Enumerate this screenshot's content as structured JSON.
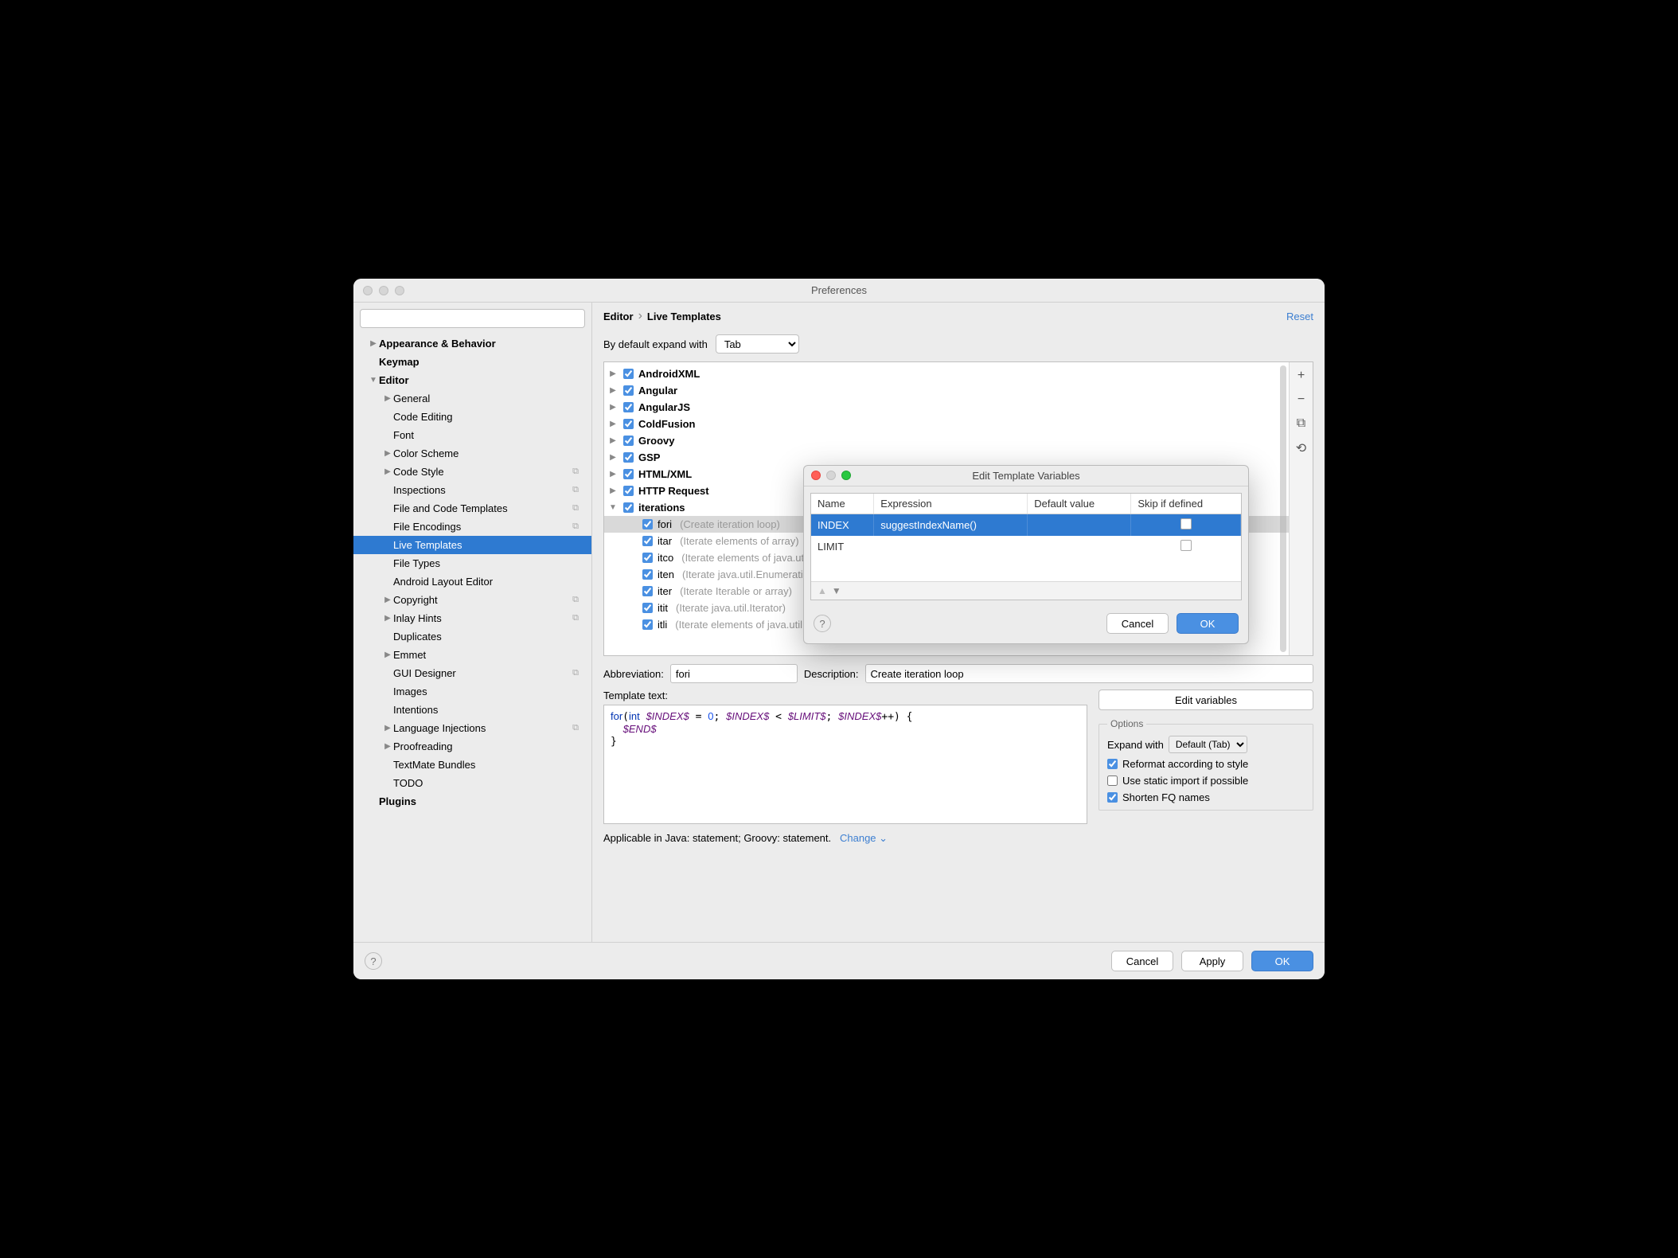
{
  "window": {
    "title": "Preferences"
  },
  "breadcrumb": {
    "parent": "Editor",
    "current": "Live Templates",
    "reset": "Reset"
  },
  "search": {
    "placeholder": ""
  },
  "sidebar": [
    {
      "label": "Appearance & Behavior",
      "depth": 0,
      "arrow": "right",
      "bold": true
    },
    {
      "label": "Keymap",
      "depth": 0,
      "arrow": "none",
      "bold": true
    },
    {
      "label": "Editor",
      "depth": 0,
      "arrow": "down",
      "bold": true
    },
    {
      "label": "General",
      "depth": 1,
      "arrow": "right"
    },
    {
      "label": "Code Editing",
      "depth": 1,
      "arrow": "none"
    },
    {
      "label": "Font",
      "depth": 1,
      "arrow": "none"
    },
    {
      "label": "Color Scheme",
      "depth": 1,
      "arrow": "right"
    },
    {
      "label": "Code Style",
      "depth": 1,
      "arrow": "right",
      "badge": "⧉"
    },
    {
      "label": "Inspections",
      "depth": 1,
      "arrow": "none",
      "badge": "⧉"
    },
    {
      "label": "File and Code Templates",
      "depth": 1,
      "arrow": "none",
      "badge": "⧉"
    },
    {
      "label": "File Encodings",
      "depth": 1,
      "arrow": "none",
      "badge": "⧉"
    },
    {
      "label": "Live Templates",
      "depth": 1,
      "arrow": "none",
      "selected": true
    },
    {
      "label": "File Types",
      "depth": 1,
      "arrow": "none"
    },
    {
      "label": "Android Layout Editor",
      "depth": 1,
      "arrow": "none"
    },
    {
      "label": "Copyright",
      "depth": 1,
      "arrow": "right",
      "badge": "⧉"
    },
    {
      "label": "Inlay Hints",
      "depth": 1,
      "arrow": "right",
      "badge": "⧉"
    },
    {
      "label": "Duplicates",
      "depth": 1,
      "arrow": "none"
    },
    {
      "label": "Emmet",
      "depth": 1,
      "arrow": "right"
    },
    {
      "label": "GUI Designer",
      "depth": 1,
      "arrow": "none",
      "badge": "⧉"
    },
    {
      "label": "Images",
      "depth": 1,
      "arrow": "none"
    },
    {
      "label": "Intentions",
      "depth": 1,
      "arrow": "none"
    },
    {
      "label": "Language Injections",
      "depth": 1,
      "arrow": "right",
      "badge": "⧉"
    },
    {
      "label": "Proofreading",
      "depth": 1,
      "arrow": "right"
    },
    {
      "label": "TextMate Bundles",
      "depth": 1,
      "arrow": "none"
    },
    {
      "label": "TODO",
      "depth": 1,
      "arrow": "none"
    },
    {
      "label": "Plugins",
      "depth": 0,
      "arrow": "none",
      "bold": true
    }
  ],
  "expand": {
    "label": "By default expand with",
    "value": "Tab"
  },
  "templates": [
    {
      "label": "AndroidXML",
      "depth": 0,
      "arrow": "right",
      "checked": true,
      "bold": true
    },
    {
      "label": "Angular",
      "depth": 0,
      "arrow": "right",
      "checked": true,
      "bold": true
    },
    {
      "label": "AngularJS",
      "depth": 0,
      "arrow": "right",
      "checked": true,
      "bold": true
    },
    {
      "label": "ColdFusion",
      "depth": 0,
      "arrow": "right",
      "checked": true,
      "bold": true
    },
    {
      "label": "Groovy",
      "depth": 0,
      "arrow": "right",
      "checked": true,
      "bold": true
    },
    {
      "label": "GSP",
      "depth": 0,
      "arrow": "right",
      "checked": true,
      "bold": true
    },
    {
      "label": "HTML/XML",
      "depth": 0,
      "arrow": "right",
      "checked": true,
      "bold": true
    },
    {
      "label": "HTTP Request",
      "depth": 0,
      "arrow": "right",
      "checked": true,
      "bold": true
    },
    {
      "label": "iterations",
      "depth": 0,
      "arrow": "down",
      "checked": true,
      "bold": true
    },
    {
      "label": "fori",
      "desc": "(Create iteration loop)",
      "depth": 1,
      "arrow": "none",
      "checked": true,
      "selected": true
    },
    {
      "label": "itar",
      "desc": "(Iterate elements of array)",
      "depth": 1,
      "arrow": "none",
      "checked": true
    },
    {
      "label": "itco",
      "desc": "(Iterate elements of java.util.Collection)",
      "depth": 1,
      "arrow": "none",
      "checked": true
    },
    {
      "label": "iten",
      "desc": "(Iterate java.util.Enumeration)",
      "depth": 1,
      "arrow": "none",
      "checked": true
    },
    {
      "label": "iter",
      "desc": "(Iterate Iterable or array)",
      "depth": 1,
      "arrow": "none",
      "checked": true
    },
    {
      "label": "itit",
      "desc": "(Iterate java.util.Iterator)",
      "depth": 1,
      "arrow": "none",
      "checked": true
    },
    {
      "label": "itli",
      "desc": "(Iterate elements of java.util.List)",
      "depth": 1,
      "arrow": "none",
      "checked": true
    }
  ],
  "rightToolbar": {
    "add": "+",
    "remove": "−",
    "duplicate": "⧉",
    "revert": "⟲"
  },
  "form": {
    "abbrLabel": "Abbreviation:",
    "abbrValue": "fori",
    "descLabel": "Description:",
    "descValue": "Create iteration loop",
    "ttLabel": "Template text:",
    "editVars": "Edit variables",
    "optionsLegend": "Options",
    "expandWithLabel": "Expand with",
    "expandWithValue": "Default (Tab)",
    "reformat": "Reformat according to style",
    "staticImport": "Use static import if possible",
    "shorten": "Shorten FQ names",
    "applicable": "Applicable in Java: statement; Groovy: statement.",
    "change": "Change"
  },
  "footer": {
    "cancel": "Cancel",
    "apply": "Apply",
    "ok": "OK"
  },
  "dialog": {
    "title": "Edit Template Variables",
    "columns": [
      "Name",
      "Expression",
      "Default value",
      "Skip if defined"
    ],
    "rows": [
      {
        "name": "INDEX",
        "expr": "suggestIndexName()",
        "def": "",
        "skip": false,
        "selected": true
      },
      {
        "name": "LIMIT",
        "expr": "",
        "def": "",
        "skip": false
      }
    ],
    "cancel": "Cancel",
    "ok": "OK"
  }
}
